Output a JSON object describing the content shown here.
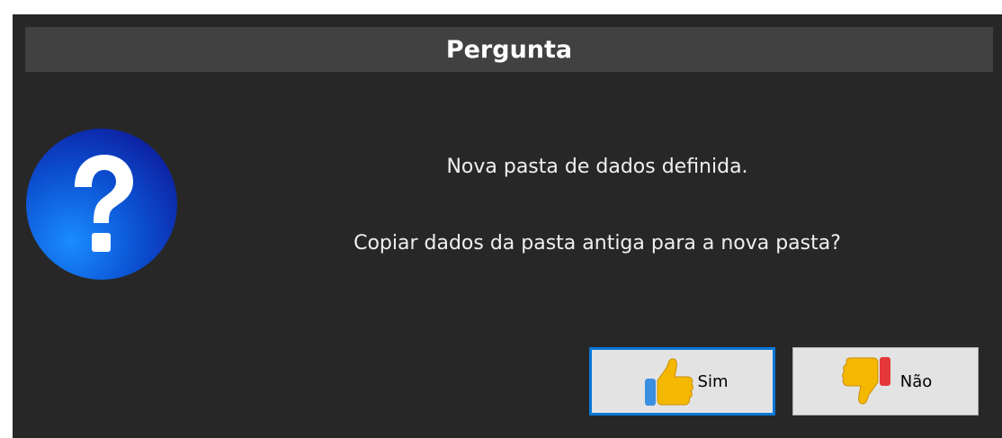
{
  "dialog": {
    "title": "Pergunta",
    "message_line1": "Nova pasta de dados definida.",
    "message_line2": "Copiar dados da pasta antiga para a nova pasta?",
    "icon": "question-icon"
  },
  "buttons": {
    "yes_label": "Sim",
    "yes_icon": "thumbs-up-icon",
    "no_label": "Não",
    "no_icon": "thumbs-down-icon"
  },
  "colors": {
    "dialog_bg": "#272727",
    "title_bar_bg": "#414141",
    "default_button_border": "#0a78d7",
    "button_bg": "#e3e3e3",
    "thumb_yellow": "#f5b800",
    "thumb_up_accent": "#3b8fe0",
    "thumb_down_accent": "#e5383b",
    "icon_blue_dark": "#0d1fa0",
    "icon_blue_light": "#1a8cff"
  }
}
